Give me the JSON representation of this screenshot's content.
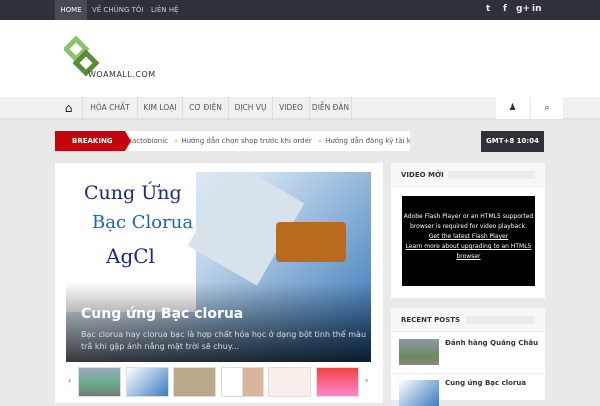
{
  "topbar": {
    "links": [
      "HOME",
      "VỀ CHÚNG TÔI",
      "LIÊN HỆ"
    ],
    "social": [
      "twitter-icon",
      "facebook-icon",
      "google-plus-icon",
      "linkedin-icon"
    ]
  },
  "logo": {
    "text": "WOAMALL.COM"
  },
  "nav": {
    "items": [
      "HÓA CHẤT",
      "KIM LOẠI",
      "CƠ ĐIỆN",
      "DỊCH VỤ",
      "VIDEO",
      "DIỄN ĐÀN"
    ]
  },
  "breaking": {
    "label": "BREAKING",
    "items": [
      "lactobionic",
      "Hướng dẫn chọn shop trước khi order",
      "Hướng dẫn đăng ký tài k"
    ],
    "clock": "GMT+8 10:04"
  },
  "slider": {
    "image_text": [
      "Cung Ứng",
      "Bạc Clorua",
      "AgCl"
    ],
    "title": "Cung ứng Bạc clorua",
    "desc": "Bạc clorua hay clorua bạc là hợp chất hóa học ở dạng bột tinh thể màu trắ khi gặp ánh nắng mặt trời sẽ chuy..."
  },
  "video_widget": {
    "title": "VIDEO MỚI",
    "msg": "Adobe Flash Player or an HTML5 supported browser is required for video playback.",
    "link1": "Get the latest Flash Player",
    "link2": "Learn more about upgrading to an HTML5 browser"
  },
  "recent": {
    "title": "RECENT POSTS",
    "posts": [
      "Đánh hàng Quảng Châu",
      "Cung ứng Bạc clorua"
    ]
  }
}
